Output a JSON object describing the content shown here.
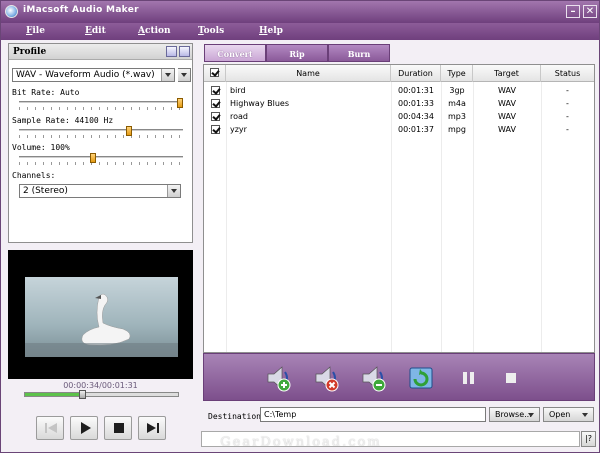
{
  "window": {
    "title": "iMacsoft Audio Maker",
    "controls": {
      "minimize": "–",
      "close": "✕"
    }
  },
  "menu": [
    "File",
    "Edit",
    "Action",
    "Tools",
    "Help"
  ],
  "profile": {
    "title": "Profile",
    "format": "WAV - Waveform Audio  (*.wav)",
    "bit_rate_label": "Bit Rate: Auto",
    "bit_rate_level": 1.0,
    "sample_rate_label": "Sample Rate: 44100 Hz",
    "sample_rate_level": 0.68,
    "volume_label": "Volume: 100%",
    "volume_level": 0.45,
    "channels_label": "Channels:",
    "channels_value": "2 (Stereo)"
  },
  "player": {
    "time": "00:00:34/00:01:31",
    "progress": 0.37
  },
  "tabs": [
    "Convert",
    "Rip",
    "Burn"
  ],
  "file_list": {
    "columns": [
      "Name",
      "Duration",
      "Type",
      "Target",
      "Status"
    ],
    "rows": [
      {
        "name": "bird",
        "duration": "00:01:31",
        "type": "3gp",
        "target": "WAV",
        "status": "-"
      },
      {
        "name": "Highway Blues",
        "duration": "00:01:33",
        "type": "m4a",
        "target": "WAV",
        "status": "-"
      },
      {
        "name": "road",
        "duration": "00:04:34",
        "type": "mp3",
        "target": "WAV",
        "status": "-"
      },
      {
        "name": "yzyr",
        "duration": "00:01:37",
        "type": "mpg",
        "target": "WAV",
        "status": "-"
      }
    ]
  },
  "destination": {
    "label": "Destination:",
    "value": "C:\\Temp",
    "browse": "Browse...",
    "open": "Open"
  },
  "help_label": "|?",
  "watermark": "GearDownload.com",
  "colors": {
    "accent": "#7d4f8c",
    "seek": "#5cc24a",
    "thumb": "#e49a12"
  }
}
